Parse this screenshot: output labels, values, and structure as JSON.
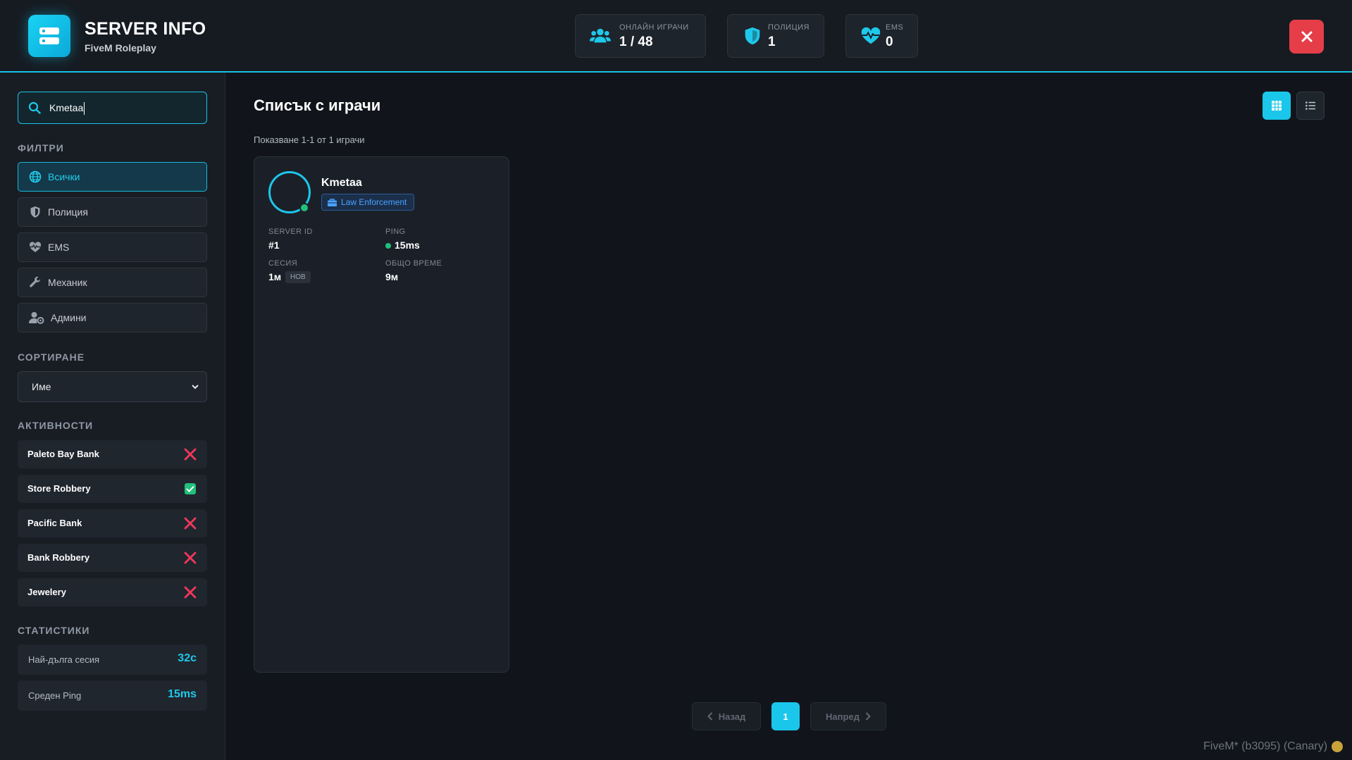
{
  "header": {
    "title": "SERVER INFO",
    "subtitle": "FiveM Roleplay",
    "stats": [
      {
        "label": "ОНЛАЙН ИГРАЧИ",
        "value": "1 / 48",
        "icon": "users-icon"
      },
      {
        "label": "ПОЛИЦИЯ",
        "value": "1",
        "icon": "shield-icon"
      },
      {
        "label": "EMS",
        "value": "0",
        "icon": "heart-pulse-icon"
      }
    ],
    "close_icon": "close-icon"
  },
  "sidebar": {
    "search": {
      "value": "Kmetaa",
      "icon": "search-icon"
    },
    "filters_title": "ФИЛТРИ",
    "filters": [
      {
        "label": "Всички",
        "icon": "globe-icon",
        "active": true
      },
      {
        "label": "Полиция",
        "icon": "shield-icon",
        "active": false
      },
      {
        "label": "EMS",
        "icon": "heart-pulse-icon",
        "active": false
      },
      {
        "label": "Механик",
        "icon": "wrench-icon",
        "active": false
      },
      {
        "label": "Админи",
        "icon": "user-gear-icon",
        "active": false
      }
    ],
    "sort_title": "СОРТИРАНЕ",
    "sort_value": "Име",
    "activities_title": "АКТИВНОСТИ",
    "activities": [
      {
        "label": "Paleto Bay Bank",
        "available": false
      },
      {
        "label": "Store Robbery",
        "available": true
      },
      {
        "label": "Pacific Bank",
        "available": false
      },
      {
        "label": "Bank Robbery",
        "available": false
      },
      {
        "label": "Jewelery",
        "available": false
      }
    ],
    "stats_title": "СТАТИСТИКИ",
    "stats": [
      {
        "label": "Най-дълга сесия",
        "value": "32с"
      },
      {
        "label": "Среден Ping",
        "value": "15ms"
      }
    ]
  },
  "main": {
    "title": "Списък с играчи",
    "showing": "Показване 1-1 от 1 играчи",
    "players": [
      {
        "name": "Kmetaa",
        "job": "Law Enforcement",
        "server_id_label": "SERVER ID",
        "server_id": "#1",
        "ping_label": "PING",
        "ping": "15ms",
        "session_label": "СЕСИЯ",
        "session": "1м",
        "session_badge": "НОВ",
        "total_label": "ОБЩО ВРЕМЕ",
        "total": "9м"
      }
    ],
    "pagination": {
      "prev": "Назад",
      "current": "1",
      "next": "Напред"
    }
  },
  "footer": {
    "build": "FiveM* (b3095) (Canary)"
  },
  "colors": {
    "accent": "#1ac7ea",
    "danger": "#e53e49",
    "success": "#22c07a",
    "badge": "#4aa2ff"
  }
}
